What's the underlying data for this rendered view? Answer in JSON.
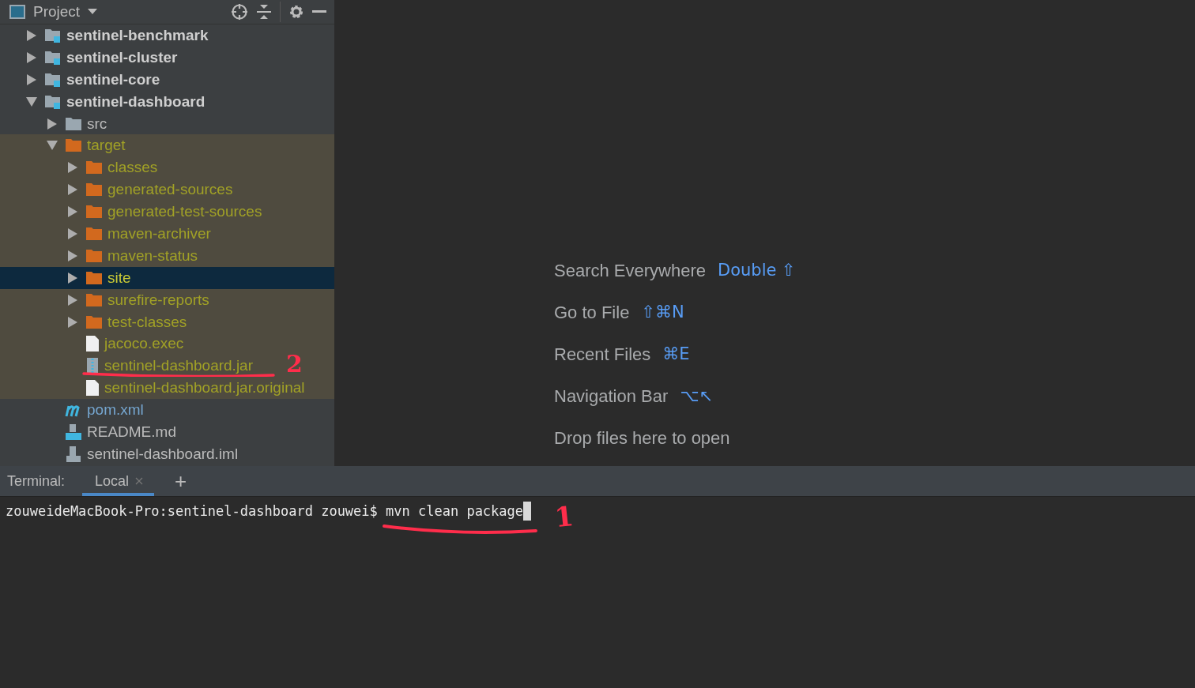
{
  "project_panel": {
    "title": "Project",
    "tree": [
      {
        "name": "sentinel-benchmark",
        "kind": "module",
        "expanded": false,
        "selected": false,
        "excluded": false
      },
      {
        "name": "sentinel-cluster",
        "kind": "module",
        "expanded": false,
        "selected": false,
        "excluded": false
      },
      {
        "name": "sentinel-core",
        "kind": "module",
        "expanded": false,
        "selected": false,
        "excluded": false
      },
      {
        "name": "sentinel-dashboard",
        "kind": "module",
        "expanded": true,
        "selected": false,
        "excluded": false,
        "children": [
          {
            "name": "src",
            "kind": "folder",
            "expanded": false,
            "selected": false,
            "excluded": false
          },
          {
            "name": "target",
            "kind": "folder",
            "expanded": true,
            "selected": false,
            "excluded": true,
            "children": [
              {
                "name": "classes",
                "kind": "folder",
                "expanded": false,
                "selected": false,
                "excluded": true
              },
              {
                "name": "generated-sources",
                "kind": "folder",
                "expanded": false,
                "selected": false,
                "excluded": true
              },
              {
                "name": "generated-test-sources",
                "kind": "folder",
                "expanded": false,
                "selected": false,
                "excluded": true
              },
              {
                "name": "maven-archiver",
                "kind": "folder",
                "expanded": false,
                "selected": false,
                "excluded": true
              },
              {
                "name": "maven-status",
                "kind": "folder",
                "expanded": false,
                "selected": false,
                "excluded": true
              },
              {
                "name": "site",
                "kind": "folder",
                "expanded": false,
                "selected": true,
                "excluded": true
              },
              {
                "name": "surefire-reports",
                "kind": "folder",
                "expanded": false,
                "selected": false,
                "excluded": true
              },
              {
                "name": "test-classes",
                "kind": "folder",
                "expanded": false,
                "selected": false,
                "excluded": true
              },
              {
                "name": "jacoco.exec",
                "kind": "file",
                "selected": false,
                "excluded": true
              },
              {
                "name": "sentinel-dashboard.jar",
                "kind": "jar",
                "selected": false,
                "excluded": true,
                "annotation": "2"
              },
              {
                "name": "sentinel-dashboard.jar.original",
                "kind": "file",
                "selected": false,
                "excluded": true
              }
            ]
          },
          {
            "name": "pom.xml",
            "kind": "maven",
            "selected": false,
            "excluded": false
          },
          {
            "name": "README.md",
            "kind": "markdown",
            "selected": false,
            "excluded": false
          },
          {
            "name": "sentinel-dashboard.iml",
            "kind": "iml",
            "selected": false,
            "excluded": false
          }
        ]
      }
    ]
  },
  "editor_hints": [
    {
      "label": "Search Everywhere",
      "shortcut": "Double ⇧"
    },
    {
      "label": "Go to File",
      "shortcut": "⇧⌘N"
    },
    {
      "label": "Recent Files",
      "shortcut": "⌘E"
    },
    {
      "label": "Navigation Bar",
      "shortcut": "⌥↖"
    },
    {
      "label": "Drop files here to open"
    }
  ],
  "terminal": {
    "title": "Terminal:",
    "tabs": [
      {
        "label": "Local",
        "selected": true
      }
    ],
    "new_tab": "+",
    "prompt": "zouweideMacBook-Pro:sentinel-dashboard zouwei$ ",
    "command": "mvn clean package",
    "cursor": true,
    "annotation": "1"
  }
}
